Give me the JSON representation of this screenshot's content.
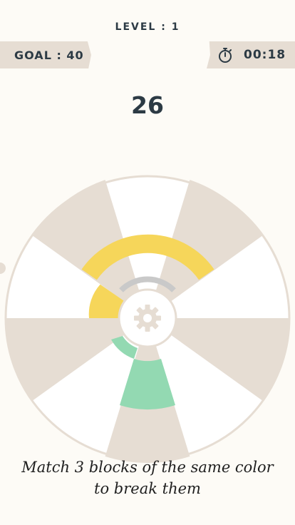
{
  "header": {
    "level_label": "LEVEL : 1",
    "goal_label": "GOAL : 40",
    "timer_value": "00:18",
    "timer_icon": "stopwatch-icon"
  },
  "score": "26",
  "board": {
    "center_icon": "gear-icon",
    "rings": [
      {
        "color": "#f6d65a",
        "segments": "upper-left & top"
      },
      {
        "color": "#c9c9c9",
        "segments": "inner top"
      },
      {
        "color": "#93d9b2",
        "segments": "lower-left & bottom"
      }
    ]
  },
  "hint": {
    "line1": "Match 3 blocks of the same color",
    "line2": "to break them"
  },
  "colors": {
    "background": "#fdfbf6",
    "text": "#2c3a44",
    "tag": "#e6ddd3",
    "wedge_beige": "#e6ddd3",
    "wedge_white": "#ffffff",
    "yellow": "#f6d65a",
    "green": "#93d9b2",
    "grey": "#c9c9c9"
  }
}
